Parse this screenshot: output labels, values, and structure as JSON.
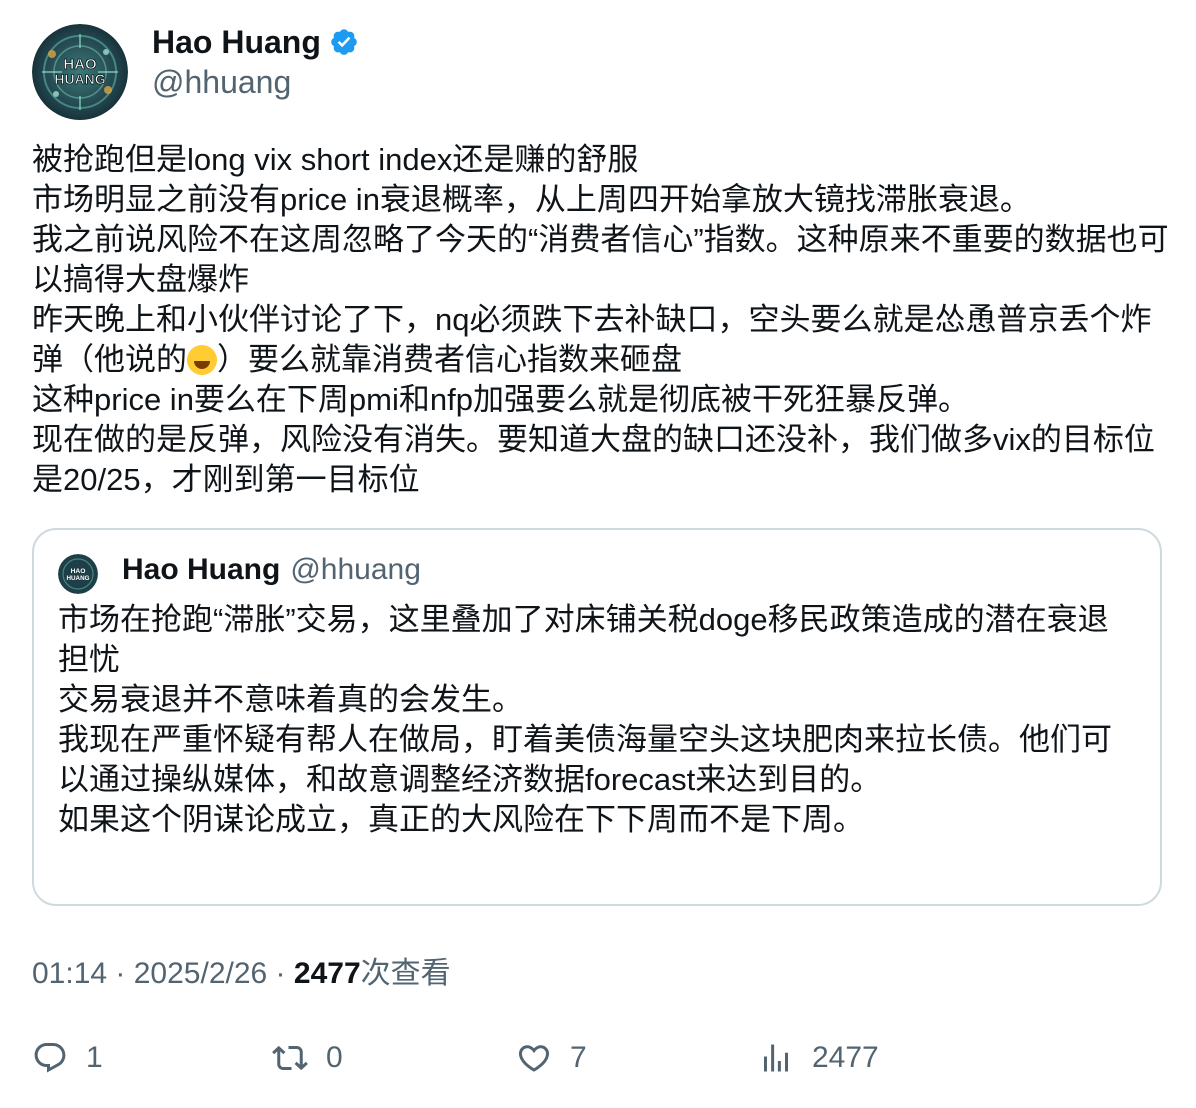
{
  "author": {
    "name": "Hao Huang",
    "handle": "@hhuang",
    "avatar_text": "HAO HUANG"
  },
  "tweet": {
    "text": "被抢跑但是long vix short index还是赚的舒服\n市场明显之前没有price in衰退概率，从上周四开始拿放大镜找滞胀衰退。\n我之前说风险不在这周忽略了今天的“消费者信心”指数。这种原来不重要的数据也可以搞得大盘爆炸\n昨天晚上和小伙伴讨论了下，nq必须跌下去补缺口，空头要么就是怂恿普京丢个炸弹（他说的",
    "text_after_emoji": "）要么就靠消费者信心指数来砸盘\n这种price in要么在下周pmi和nfp加强要么就是彻底被干死狂暴反弹。\n现在做的是反弹，风险没有消失。要知道大盘的缺口还没补，我们做多vix的目标位是20/25，才刚到第一目标位",
    "emoji": "grinning-squinting-face"
  },
  "quote": {
    "name": "Hao Huang",
    "handle": "@hhuang",
    "text": "市场在抢跑“滞胀”交易，这里叠加了对床铺关税doge移民政策造成的潜在衰退担忧\n交易衰退并不意味着真的会发生。\n我现在严重怀疑有帮人在做局，盯着美债海量空头这块肥肉来拉长债。他们可以通过操纵媒体，和故意调整经济数据forecast来达到目的。\n如果这个阴谋论成立，真正的大风险在下下周而不是下周。"
  },
  "meta": {
    "time": "01:14",
    "sep1": " · ",
    "date": "2025/2/26",
    "sep2": " · ",
    "views": "2477",
    "views_label": "次查看"
  },
  "actions": {
    "reply_count": "1",
    "retweet_count": "0",
    "like_count": "7",
    "view_count": "2477"
  },
  "colors": {
    "verified": "#1d9bf0",
    "secondary_text": "#536471",
    "border": "#cfd9de"
  }
}
